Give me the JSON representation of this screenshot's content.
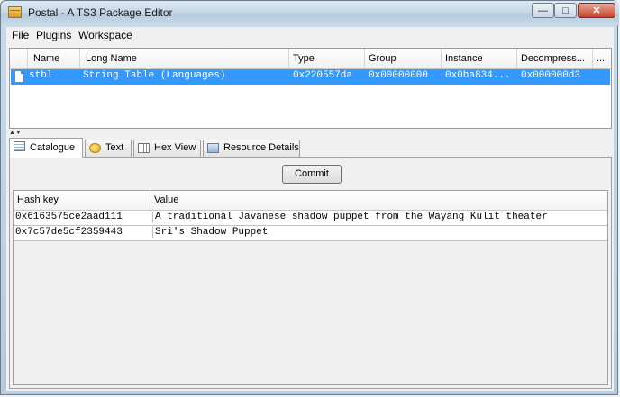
{
  "window": {
    "title": "Postal - A TS3 Package Editor",
    "controls": {
      "minimize": "—",
      "maximize": "□",
      "close": "✕"
    }
  },
  "menu": [
    "File",
    "Plugins",
    "Workspace"
  ],
  "resource_table": {
    "columns": [
      "Name",
      "Long Name",
      "Type",
      "Group",
      "Instance",
      "Decompress...",
      "..."
    ],
    "rows": [
      {
        "name": "stbl",
        "long_name": "String Table (Languages)",
        "type": "0x220557da",
        "group": "0x00000000",
        "instance": "0x0ba834...",
        "decompressed": "0x000000d3",
        "selected": true
      }
    ]
  },
  "tabs": [
    {
      "label": "Catalogue",
      "icon": "catalogue-icon",
      "active": true
    },
    {
      "label": "Text",
      "icon": "text-icon",
      "active": false
    },
    {
      "label": "Hex View",
      "icon": "hex-view-icon",
      "active": false
    },
    {
      "label": "Resource Details",
      "icon": "resource-details-icon",
      "active": false
    }
  ],
  "catalogue": {
    "commit_label": "Commit",
    "columns": [
      "Hash key",
      "Value"
    ],
    "rows": [
      {
        "key": "0x6163575ce2aad111",
        "value": "A traditional Javanese shadow puppet from the Wayang Kulit theater"
      },
      {
        "key": "0x7c57de5cf2359443",
        "value": "Sri's Shadow Puppet"
      }
    ]
  },
  "colors": {
    "selection": "#3399ff",
    "close_button": "#c6452c",
    "window_frame": "#b8cadb"
  }
}
